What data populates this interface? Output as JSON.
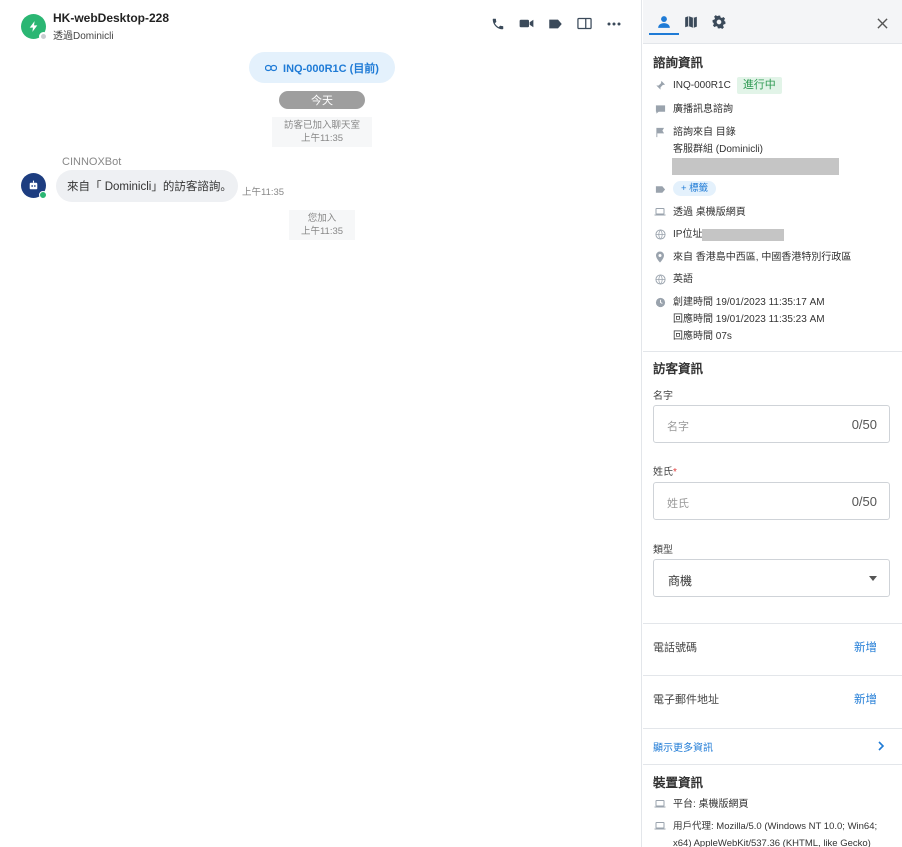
{
  "chat": {
    "contact_name": "HK-webDesktop-228",
    "contact_sub": "透過Dominicli",
    "inquiry_pill": "INQ-000R1C (目前)",
    "today": "今天",
    "system_joined": {
      "line1": "訪客已加入聊天室",
      "line2": "上午11:35"
    },
    "bot_name": "CINNOXBot",
    "bot_message": "來自「 Dominicli」的訪客諮詢。",
    "bot_message_time": "上午11:35",
    "system_you_joined": {
      "line1": "您加入",
      "line2": "上午11:35"
    },
    "header_icons": [
      "phone-icon",
      "video-icon",
      "tag-icon",
      "split-view-icon",
      "more-icon"
    ]
  },
  "panel": {
    "tabs": [
      "user-icon",
      "map-icon",
      "gear-icon"
    ],
    "inquiry_section": {
      "title": "諮詢資訊",
      "inquiry_id": "INQ-000R1C",
      "status": "進行中",
      "type": "廣播訊息諮詢",
      "from_line1": "諮詢來自 目錄",
      "from_line2": "客服群組 (Dominicli)",
      "add_tag": "+ 標籤",
      "via": "透過 桌機版網頁",
      "ip_label": "IP位址",
      "location": "來自 香港島中西區, 中國香港特別行政區",
      "language": "英語",
      "created": "創建時間 19/01/2023 11:35:17 AM",
      "responded": "回應時間 19/01/2023 11:35:23 AM",
      "response_time": "回應時間 07s"
    },
    "visitor_section": {
      "title": "訪客資訊",
      "first_name_label": "名字",
      "first_name_placeholder": "名字",
      "first_name_count": "0/50",
      "last_name_label": "姓氏",
      "last_name_required": "*",
      "last_name_placeholder": "姓氏",
      "last_name_count": "0/50",
      "category_label": "類型",
      "category_value": "商機",
      "phone_label": "電話號碼",
      "phone_add": "新增",
      "email_label": "電子郵件地址",
      "email_add": "新增",
      "show_more": "顯示更多資訊"
    },
    "device_section": {
      "title": "裝置資訊",
      "platform": "平台:  桌機版網頁",
      "ua_line1": "用戶代理:  Mozilla/5.0 (Windows NT 10.0; Win64;",
      "ua_line2": "x64) AppleWebKit/537.36 (KHTML, like Gecko)"
    }
  },
  "colors": {
    "accent": "#1f7bd6",
    "status_green": "#2e9a52",
    "contact_green": "#2bb673",
    "bot_navy": "#1d3d80"
  }
}
